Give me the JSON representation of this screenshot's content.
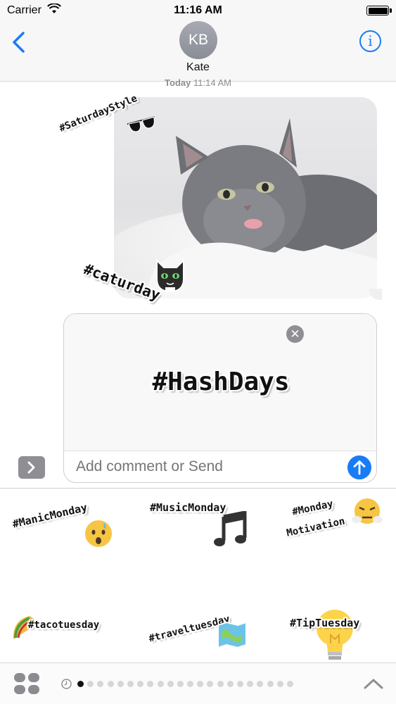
{
  "status_bar": {
    "carrier": "Carrier",
    "time": "11:16 AM",
    "battery_level": 1.0
  },
  "header": {
    "back_icon": "chevron-left-icon",
    "avatar_initials": "KB",
    "contact_name": "Kate",
    "info_icon": "info-icon",
    "info_symbol": "i"
  },
  "conversation": {
    "timestamp_day": "Today",
    "timestamp_time": "11:14 AM",
    "photo_stickers": [
      {
        "text": "#SaturdayStyle",
        "icon": "sunglasses-icon"
      },
      {
        "text": "#caturday",
        "icon": "cat-icon"
      }
    ]
  },
  "compose": {
    "sticker_text": "#HashDays",
    "remove_symbol": "✕",
    "placeholder": "Add comment or Send",
    "send_icon": "arrow-up-icon",
    "expand_icon": "chevron-right-icon"
  },
  "sticker_drawer": {
    "stickers": [
      {
        "text": "#ManicMonday",
        "icon": "anxious-face-icon"
      },
      {
        "text": "#MusicMonday",
        "icon": "music-note-icon"
      },
      {
        "line1": "#Monday",
        "line2": "Motivation",
        "icon": "steaming-face-icon"
      },
      {
        "text": "#tacotuesday",
        "icon": "taco-icon"
      },
      {
        "text": "#traveltuesday",
        "icon": "map-icon"
      },
      {
        "text": "#TipTuesday",
        "icon": "light-bulb-icon"
      }
    ]
  },
  "bottom_bar": {
    "apps_icon": "app-drawer-icon",
    "recent_icon": "clock-icon",
    "page_count": 22,
    "current_page": 1,
    "collapse_icon": "chevron-up-icon"
  },
  "colors": {
    "accent": "#1a7cf5",
    "avatar": "#9a9da5",
    "muted": "#8e8e93"
  }
}
